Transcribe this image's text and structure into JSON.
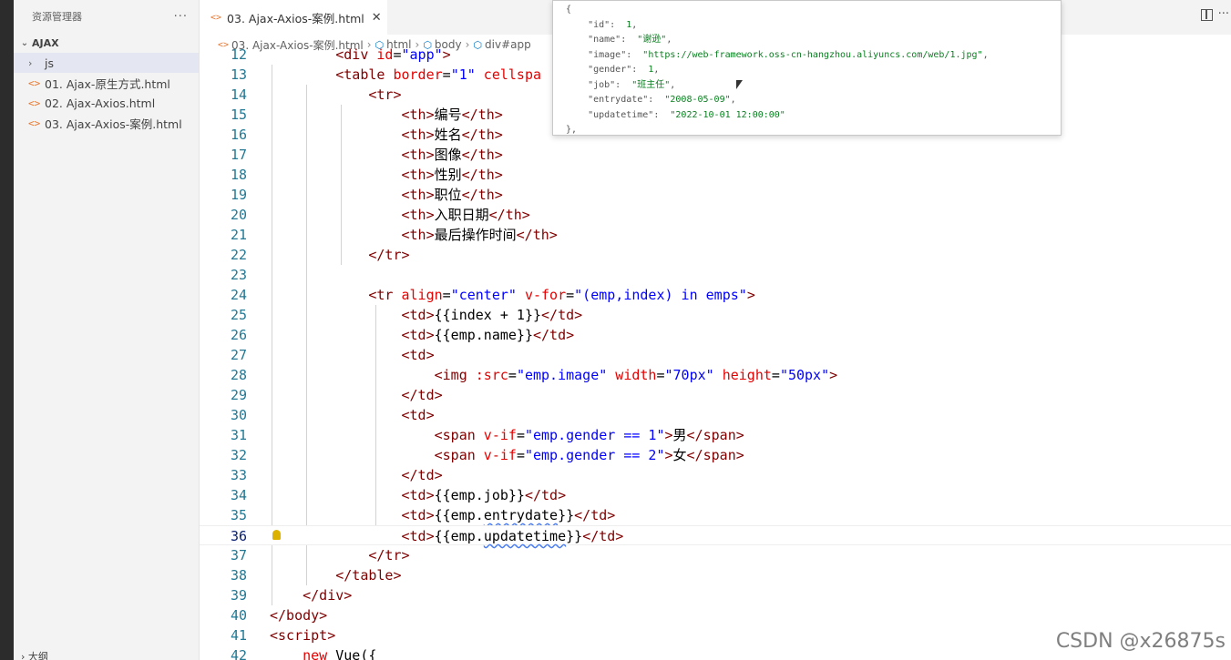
{
  "sidebar": {
    "title": "资源管理器",
    "more": "···",
    "section": "AJAX",
    "items": [
      {
        "label": "js",
        "type": "folder"
      },
      {
        "label": "01. Ajax-原生方式.html",
        "type": "file"
      },
      {
        "label": "02. Ajax-Axios.html",
        "type": "file"
      },
      {
        "label": "03. Ajax-Axios-案例.html",
        "type": "file"
      }
    ],
    "bottom": "大纲"
  },
  "tab": {
    "label": "03. Ajax-Axios-案例.html",
    "close": "✕"
  },
  "breadcrumb": [
    "03. Ajax-Axios-案例.html",
    "html",
    "body",
    "div#app"
  ],
  "editor": {
    "lines": [
      {
        "n": "12",
        "tokens": [
          [
            "p",
            "        "
          ],
          [
            "t",
            "<div"
          ],
          [
            "a",
            " id"
          ],
          [
            "p",
            "="
          ],
          [
            "s",
            "\"app\""
          ],
          [
            "t",
            ">"
          ]
        ]
      },
      {
        "n": "13",
        "tokens": [
          [
            "p",
            "        "
          ],
          [
            "t",
            "<table"
          ],
          [
            "a",
            " border"
          ],
          [
            "p",
            "="
          ],
          [
            "s",
            "\"1\""
          ],
          [
            "a",
            " cellspa"
          ]
        ]
      },
      {
        "n": "14",
        "tokens": [
          [
            "p",
            "            "
          ],
          [
            "t",
            "<tr>"
          ]
        ]
      },
      {
        "n": "15",
        "tokens": [
          [
            "p",
            "                "
          ],
          [
            "t",
            "<th>"
          ],
          [
            "p",
            "编号"
          ],
          [
            "t",
            "</th>"
          ]
        ]
      },
      {
        "n": "16",
        "tokens": [
          [
            "p",
            "                "
          ],
          [
            "t",
            "<th>"
          ],
          [
            "p",
            "姓名"
          ],
          [
            "t",
            "</th>"
          ]
        ]
      },
      {
        "n": "17",
        "tokens": [
          [
            "p",
            "                "
          ],
          [
            "t",
            "<th>"
          ],
          [
            "p",
            "图像"
          ],
          [
            "t",
            "</th>"
          ]
        ]
      },
      {
        "n": "18",
        "tokens": [
          [
            "p",
            "                "
          ],
          [
            "t",
            "<th>"
          ],
          [
            "p",
            "性别"
          ],
          [
            "t",
            "</th>"
          ]
        ]
      },
      {
        "n": "19",
        "tokens": [
          [
            "p",
            "                "
          ],
          [
            "t",
            "<th>"
          ],
          [
            "p",
            "职位"
          ],
          [
            "t",
            "</th>"
          ]
        ]
      },
      {
        "n": "20",
        "tokens": [
          [
            "p",
            "                "
          ],
          [
            "t",
            "<th>"
          ],
          [
            "p",
            "入职日期"
          ],
          [
            "t",
            "</th>"
          ]
        ]
      },
      {
        "n": "21",
        "tokens": [
          [
            "p",
            "                "
          ],
          [
            "t",
            "<th>"
          ],
          [
            "p",
            "最后操作时间"
          ],
          [
            "t",
            "</th>"
          ]
        ]
      },
      {
        "n": "22",
        "tokens": [
          [
            "p",
            "            "
          ],
          [
            "t",
            "</tr>"
          ]
        ]
      },
      {
        "n": "23",
        "tokens": []
      },
      {
        "n": "24",
        "tokens": [
          [
            "p",
            "            "
          ],
          [
            "t",
            "<tr"
          ],
          [
            "a",
            " align"
          ],
          [
            "p",
            "="
          ],
          [
            "s",
            "\"center\""
          ],
          [
            "a",
            " v-for"
          ],
          [
            "p",
            "="
          ],
          [
            "s",
            "\"(emp,index) in emps\""
          ],
          [
            "t",
            ">"
          ]
        ]
      },
      {
        "n": "25",
        "tokens": [
          [
            "p",
            "                "
          ],
          [
            "t",
            "<td>"
          ],
          [
            "p",
            "{{index + 1}}"
          ],
          [
            "t",
            "</td>"
          ]
        ]
      },
      {
        "n": "26",
        "tokens": [
          [
            "p",
            "                "
          ],
          [
            "t",
            "<td>"
          ],
          [
            "p",
            "{{emp.name}}"
          ],
          [
            "t",
            "</td>"
          ]
        ]
      },
      {
        "n": "27",
        "tokens": [
          [
            "p",
            "                "
          ],
          [
            "t",
            "<td>"
          ]
        ]
      },
      {
        "n": "28",
        "tokens": [
          [
            "p",
            "                    "
          ],
          [
            "t",
            "<img"
          ],
          [
            "a",
            " :src"
          ],
          [
            "p",
            "="
          ],
          [
            "s",
            "\"emp.image\""
          ],
          [
            "a",
            " width"
          ],
          [
            "p",
            "="
          ],
          [
            "s",
            "\"70px\""
          ],
          [
            "a",
            " height"
          ],
          [
            "p",
            "="
          ],
          [
            "s",
            "\"50px\""
          ],
          [
            "t",
            ">"
          ]
        ]
      },
      {
        "n": "29",
        "tokens": [
          [
            "p",
            "                "
          ],
          [
            "t",
            "</td>"
          ]
        ]
      },
      {
        "n": "30",
        "tokens": [
          [
            "p",
            "                "
          ],
          [
            "t",
            "<td>"
          ]
        ]
      },
      {
        "n": "31",
        "tokens": [
          [
            "p",
            "                    "
          ],
          [
            "t",
            "<span"
          ],
          [
            "a",
            " v-if"
          ],
          [
            "p",
            "="
          ],
          [
            "s",
            "\"emp.gender == 1\""
          ],
          [
            "t",
            ">"
          ],
          [
            "p",
            "男"
          ],
          [
            "t",
            "</span>"
          ]
        ]
      },
      {
        "n": "32",
        "tokens": [
          [
            "p",
            "                    "
          ],
          [
            "t",
            "<span"
          ],
          [
            "a",
            " v-if"
          ],
          [
            "p",
            "="
          ],
          [
            "s",
            "\"emp.gender == 2\""
          ],
          [
            "t",
            ">"
          ],
          [
            "p",
            "女"
          ],
          [
            "t",
            "</span>"
          ]
        ]
      },
      {
        "n": "33",
        "tokens": [
          [
            "p",
            "                "
          ],
          [
            "t",
            "</td>"
          ]
        ]
      },
      {
        "n": "34",
        "tokens": [
          [
            "p",
            "                "
          ],
          [
            "t",
            "<td>"
          ],
          [
            "p",
            "{{emp.job}}"
          ],
          [
            "t",
            "</td>"
          ]
        ]
      },
      {
        "n": "35",
        "tokens": [
          [
            "p",
            "                "
          ],
          [
            "t",
            "<td>"
          ],
          [
            "p",
            "{{emp."
          ],
          [
            "q",
            "entrydate"
          ],
          [
            "p",
            "}}"
          ],
          [
            "t",
            "</td>"
          ]
        ]
      },
      {
        "n": "36",
        "tokens": [
          [
            "p",
            "                "
          ],
          [
            "t",
            "<td>"
          ],
          [
            "p",
            "{{emp."
          ],
          [
            "q",
            "updatetime"
          ],
          [
            "p",
            "}}"
          ],
          [
            "t",
            "</td>"
          ]
        ]
      },
      {
        "n": "37",
        "tokens": [
          [
            "p",
            "            "
          ],
          [
            "t",
            "</tr>"
          ]
        ]
      },
      {
        "n": "38",
        "tokens": [
          [
            "p",
            "        "
          ],
          [
            "t",
            "</table>"
          ]
        ]
      },
      {
        "n": "39",
        "tokens": [
          [
            "p",
            "    "
          ],
          [
            "t",
            "</div>"
          ]
        ]
      },
      {
        "n": "40",
        "tokens": [
          [
            "t",
            "</body>"
          ]
        ]
      },
      {
        "n": "41",
        "tokens": [
          [
            "t",
            "<script>"
          ]
        ]
      },
      {
        "n": "42",
        "tokens": [
          [
            "p",
            "    "
          ],
          [
            "d",
            "new"
          ],
          [
            "p",
            " Vue({"
          ]
        ]
      }
    ]
  },
  "hover": {
    "lines": [
      [
        [
          "k",
          "{"
        ]
      ],
      [
        [
          "k",
          "    \"id\":  "
        ],
        [
          "n",
          "1"
        ],
        [
          "k",
          ","
        ]
      ],
      [
        [
          "k",
          "    \"name\":  "
        ],
        [
          "s",
          "\"谢逊\""
        ],
        [
          "k",
          ","
        ]
      ],
      [
        [
          "k",
          "    \"image\":  "
        ],
        [
          "s",
          "\"https://web-framework.oss-cn-hangzhou.aliyuncs.com/web/1.jpg\""
        ],
        [
          "k",
          ","
        ]
      ],
      [
        [
          "k",
          "    \"gender\":  "
        ],
        [
          "n",
          "1"
        ],
        [
          "k",
          ","
        ]
      ],
      [
        [
          "k",
          "    \"job\":  "
        ],
        [
          "s",
          "\"班主任\""
        ],
        [
          "k",
          ","
        ]
      ],
      [
        [
          "k",
          "    \"entrydate\":  "
        ],
        [
          "s",
          "\"2008-05-09\""
        ],
        [
          "k",
          ","
        ]
      ],
      [
        [
          "k",
          "    \"updatetime\":  "
        ],
        [
          "s",
          "\"2022-10-01 12:00:00\""
        ]
      ],
      [
        [
          "k",
          "},"
        ]
      ]
    ]
  },
  "watermark": "CSDN @x26875s"
}
